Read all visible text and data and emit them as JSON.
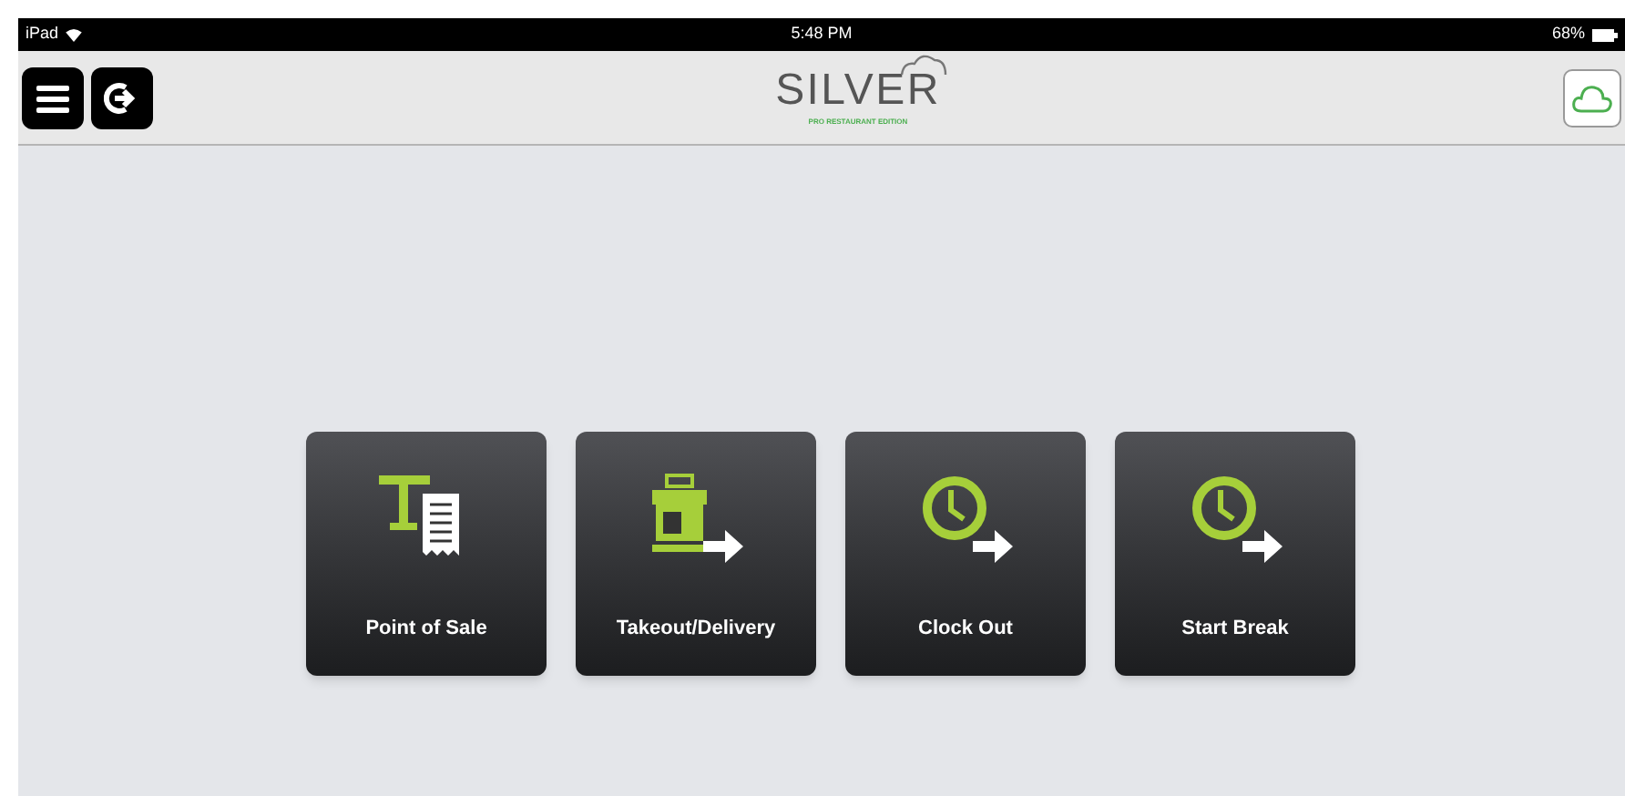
{
  "status_bar": {
    "device": "iPad",
    "time": "5:48 PM",
    "battery": "68%"
  },
  "nav_bar": {
    "logo": "SILVER",
    "logo_subtitle": "PRO RESTAURANT EDITION"
  },
  "tiles": [
    {
      "label": "Point of Sale",
      "kind": "pos"
    },
    {
      "label": "Takeout/Delivery",
      "kind": "takeout"
    },
    {
      "label": "Clock Out",
      "kind": "clock"
    },
    {
      "label": "Start Break",
      "kind": "clock"
    }
  ]
}
